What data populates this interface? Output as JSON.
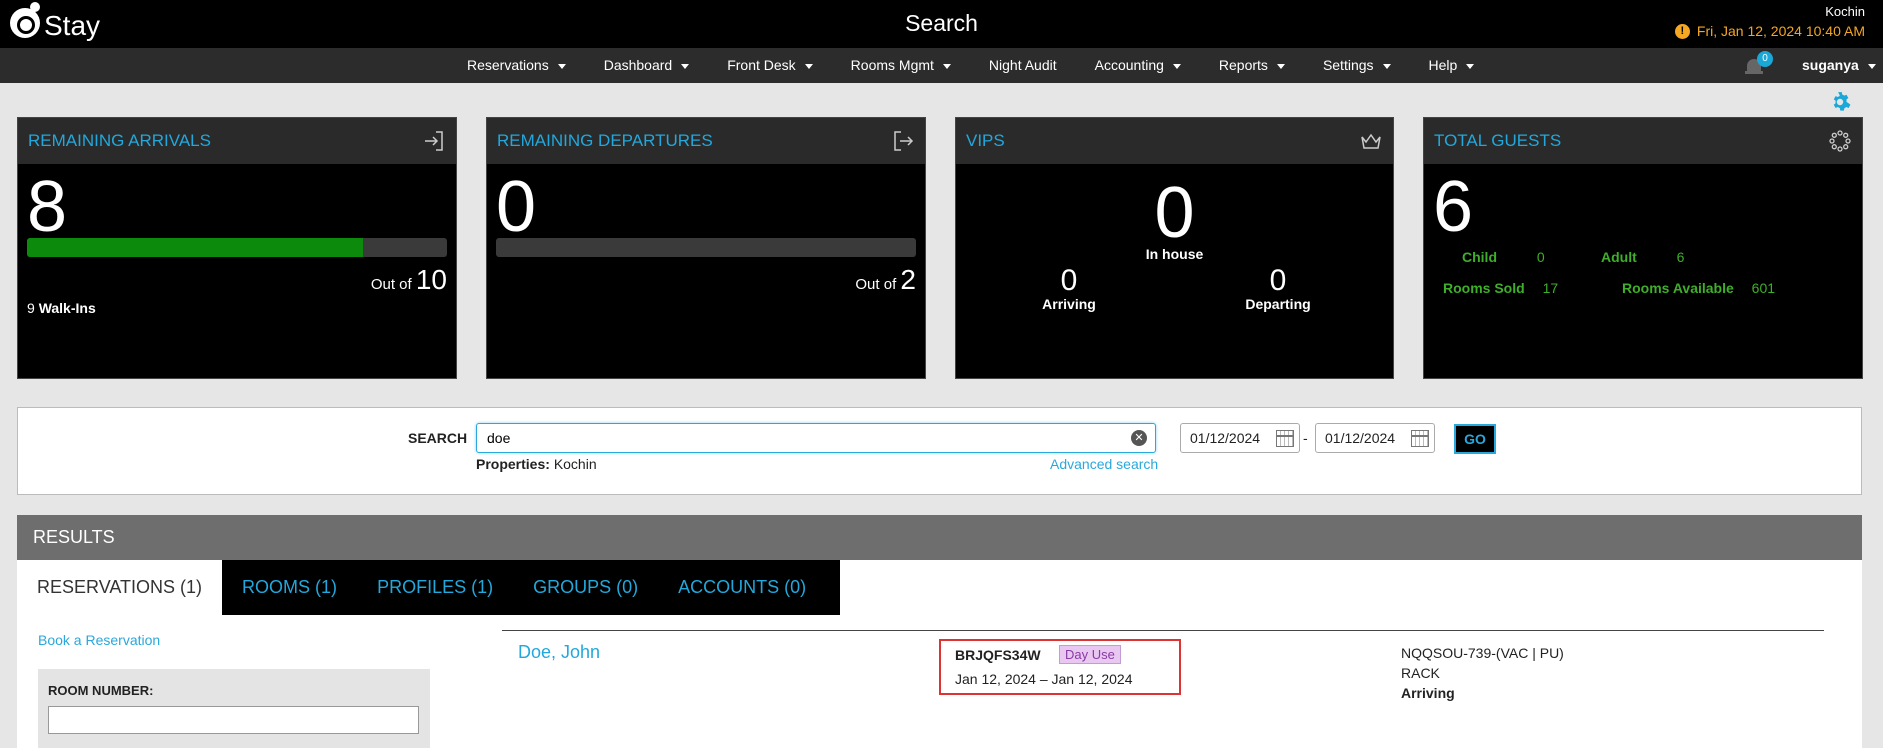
{
  "header": {
    "logo_text": "Stay",
    "page_title": "Search",
    "property": "Kochin",
    "datetime": "Fri, Jan 12, 2024 10:40 AM"
  },
  "nav": {
    "items": [
      "Reservations",
      "Dashboard",
      "Front Desk",
      "Rooms Mgmt",
      "Night Audit",
      "Accounting",
      "Reports",
      "Settings",
      "Help"
    ],
    "has_dropdown": [
      true,
      true,
      true,
      true,
      false,
      true,
      true,
      true,
      true
    ],
    "notification_count": "0",
    "user": "suganya"
  },
  "cards": {
    "arrivals": {
      "title": "REMAINING ARRIVALS",
      "value": "8",
      "out_of_label": "Out of",
      "total": "10",
      "progress_fraction": 0.8,
      "walkins_count": "9",
      "walkins_label": "Walk-Ins"
    },
    "departures": {
      "title": "REMAINING DEPARTURES",
      "value": "0",
      "out_of_label": "Out of",
      "total": "2",
      "progress_fraction": 0.0
    },
    "vips": {
      "title": "VIPS",
      "in_house": "0",
      "in_house_label": "In house",
      "arriving": "0",
      "arriving_label": "Arriving",
      "departing": "0",
      "departing_label": "Departing"
    },
    "guests": {
      "title": "TOTAL GUESTS",
      "value": "6",
      "child_label": "Child",
      "child": "0",
      "adult_label": "Adult",
      "adult": "6",
      "rooms_sold_label": "Rooms Sold",
      "rooms_sold": "17",
      "rooms_available_label": "Rooms Available",
      "rooms_available": "601"
    }
  },
  "search": {
    "label": "SEARCH",
    "value": "doe",
    "properties_label": "Properties:",
    "properties_value": "Kochin",
    "advanced_label": "Advanced search",
    "date_from": "01/12/2024",
    "date_to": "01/12/2024",
    "date_separator": "-",
    "go_label": "GO"
  },
  "results": {
    "title": "RESULTS",
    "tabs": [
      "RESERVATIONS (1)",
      "ROOMS (1)",
      "PROFILES (1)",
      "GROUPS (0)",
      "ACCOUNTS (0)"
    ],
    "active_tab": 0,
    "book_label": "Book a Reservation",
    "room_number_label": "ROOM NUMBER:",
    "room_number_value": "",
    "reservation": {
      "guest": "Doe, John",
      "confirmation": "BRJQFS34W",
      "tag": "Day Use",
      "dates": "Jan 12, 2024 – Jan 12, 2024",
      "room": "NQQSOU-739-(VAC | PU)",
      "rate": "RACK",
      "status": "Arriving"
    }
  },
  "colors": {
    "accent": "#22a8dc",
    "progress": "#0b8a0b",
    "datetime": "#f5a623",
    "stat_green": "#3fae2a",
    "highlight_border": "#dd3333"
  }
}
